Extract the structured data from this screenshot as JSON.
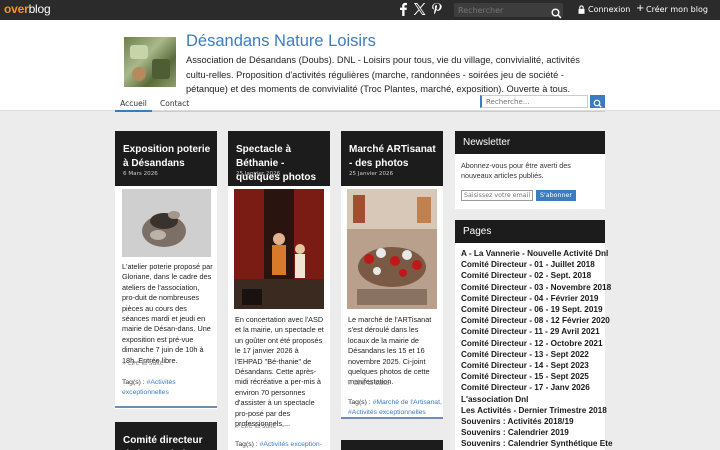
{
  "topbar": {
    "brand_over": "over",
    "brand_blog": "blog",
    "search_placeholder": "Rechercher",
    "login_label": "Connexion",
    "create_label": "Créer mon blog"
  },
  "header": {
    "title": "Désandans Nature Loisirs",
    "description": "Association de Désandans (Doubs). DNL - Loisirs pour tous, vie du village, convivialité, activités cultu-relles. Proposition d'activités régulières (marche, randonnées - soirées jeu de société - pétanque) et des moments de convivialité (Troc Plantes, marché, exposition). Ouverte à tous.",
    "nav": {
      "home": "Accueil",
      "contact": "Contact"
    },
    "search_placeholder": "Recherche..."
  },
  "posts": [
    {
      "title": "Exposition poterie à Désandans",
      "date": "6 Mars 2026",
      "text": "L'atelier poterie proposé par Gloriane, dans le cadre des ateliers de l'association, pro-duit de nombreuses pièces au cours des séances mardi et jeudi en mairie de Désan-dans. Une exposition est pré-vue dimanche 7 juin de 10h à 18h. Entrée libre.",
      "readmore": "Lire la suite",
      "tags_label": "Tag(s) :",
      "tags": "#Activités exceptionnelles"
    },
    {
      "title": "Spectacle à Béthanie - quelques photos",
      "date": "25 Janvier 2026",
      "text": "En concertation avec l'ASD et la mairie, un spectacle et un goûter ont été proposés le 17 janvier 2026 à l'EHPAD \"Bé-thanie\" de Désandans. Cette après-midi récréative a per-mis à environ 70 personnes d'assister à un spectacle pro-posé par des professionnels,...",
      "readmore": "Lire la suite",
      "tags_label": "Tag(s) :",
      "tags": "#Activités exception-"
    },
    {
      "title": "Marché ARTisanat - des photos",
      "date": "25 Janvier 2026",
      "text": "Le marché de l'ARTisanat s'est déroulé dans les locaux de la mairie de Désandans les 15 et 16 novembre 2025. Ci-joint quelques photos de cette manifestation.",
      "readmore": "Lire la suite",
      "tags_label": "Tag(s) :",
      "tags": "#Marché de l'Artisanat, #Activités exceptionnelles"
    },
    {
      "title": "Comité directeur de l'association"
    }
  ],
  "newsletter": {
    "title": "Newsletter",
    "text": "Abonnez-vous pour être averti des nouveaux articles publiés.",
    "placeholder": "Saisissez votre email ici",
    "button": "S'abonner"
  },
  "pages": {
    "title": "Pages",
    "items": [
      "A - La Vannerie - Nouvelle Activité Dnl",
      "Comité Directeur - 01 - Juillet 2018",
      "Comité Directeur - 02 - Sept. 2018",
      "Comité Directeur - 03 - Novembre 2018",
      "Comité Directeur - 04 - Février 2019",
      "Comité Directeur - 06 - 19 Sept. 2019",
      "Comité Directeur - 08 - 12 Février 2020",
      "Comité Directeur - 11 - 29 Avril 2021",
      "Comité Directeur - 12 - Octobre 2021",
      "Comité Directeur - 13 - Sept 2022",
      "Comité Directeur - 14 - Sept 2023",
      "Comité Directeur - 15 - Sept 2025",
      "Comité Directeur - 17 - Janv 2026",
      "L'association Dnl",
      "Les Activités - Dernier Trimestre 2018",
      "Souvenirs : Activités 2018/19",
      "Souvenirs : Calendrier 2019",
      "Souvenirs : Calendrier Synthétique Ete"
    ]
  }
}
